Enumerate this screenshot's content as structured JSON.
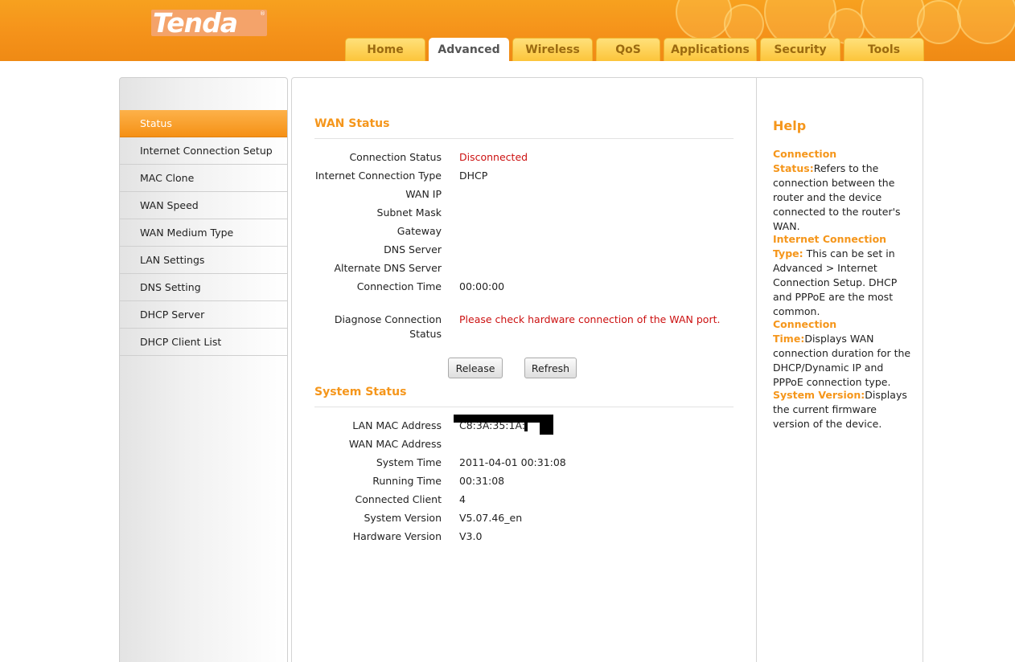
{
  "brand": {
    "logo_text": "Tenda",
    "logo_mark": "®"
  },
  "nav": {
    "tabs": [
      {
        "label": "Home",
        "active": false
      },
      {
        "label": "Advanced",
        "active": true
      },
      {
        "label": "Wireless",
        "active": false
      },
      {
        "label": "QoS",
        "active": false
      },
      {
        "label": "Applications",
        "active": false
      },
      {
        "label": "Security",
        "active": false
      },
      {
        "label": "Tools",
        "active": false
      }
    ]
  },
  "sidebar": {
    "items": [
      {
        "label": "Status",
        "active": true
      },
      {
        "label": "Internet Connection Setup",
        "active": false
      },
      {
        "label": "MAC Clone",
        "active": false
      },
      {
        "label": "WAN Speed",
        "active": false
      },
      {
        "label": "WAN Medium Type",
        "active": false
      },
      {
        "label": "LAN Settings",
        "active": false
      },
      {
        "label": "DNS Setting",
        "active": false
      },
      {
        "label": "DHCP Server",
        "active": false
      },
      {
        "label": "DHCP Client List",
        "active": false
      }
    ]
  },
  "wan": {
    "title": "WAN Status",
    "rows": [
      {
        "label": "Connection Status",
        "value": "Disconnected"
      },
      {
        "label": "Internet Connection Type",
        "value": "DHCP"
      },
      {
        "label": "WAN IP",
        "value": ""
      },
      {
        "label": "Subnet Mask",
        "value": ""
      },
      {
        "label": "Gateway",
        "value": ""
      },
      {
        "label": "DNS Server",
        "value": ""
      },
      {
        "label": "Alternate DNS Server",
        "value": ""
      },
      {
        "label": "Connection Time",
        "value": "00:00:00"
      }
    ],
    "diagnose_label_1": "Diagnose Connection",
    "diagnose_label_2": "Status",
    "diagnose_value": "Please check hardware connection of the WAN port.",
    "release_label": "Release",
    "refresh_label": "Refresh"
  },
  "system": {
    "title": "System Status",
    "rows": [
      {
        "label": "LAN MAC Address",
        "value": "C8:3A:35:1A:"
      },
      {
        "label": "WAN MAC Address",
        "value": ""
      },
      {
        "label": "System Time",
        "value": "2011-04-01 00:31:08"
      },
      {
        "label": "Running Time",
        "value": "00:31:08"
      },
      {
        "label": "Connected Client",
        "value": "4"
      },
      {
        "label": "System Version",
        "value": "V5.07.46_en"
      },
      {
        "label": "Hardware Version",
        "value": "V3.0"
      }
    ]
  },
  "help": {
    "title": "Help",
    "items": [
      {
        "key": "Connection Status:",
        "text": "Refers to the connection between the router and the device connected to the router's WAN."
      },
      {
        "key": "Internet Connection Type:",
        "text": "This can be set in Advanced > Internet Connection Setup. DHCP and PPPoE are the most common."
      },
      {
        "key": "Connection Time:",
        "text": "Displays WAN connection duration for the DHCP/Dynamic IP and PPPoE connection type."
      },
      {
        "key": "System Version:",
        "text": "Displays the current firmware version of the device."
      }
    ]
  },
  "colors": {
    "accent": "#f5961b",
    "header": "#f5921a",
    "tab": "#fcc53a",
    "error": "#cc1111"
  }
}
